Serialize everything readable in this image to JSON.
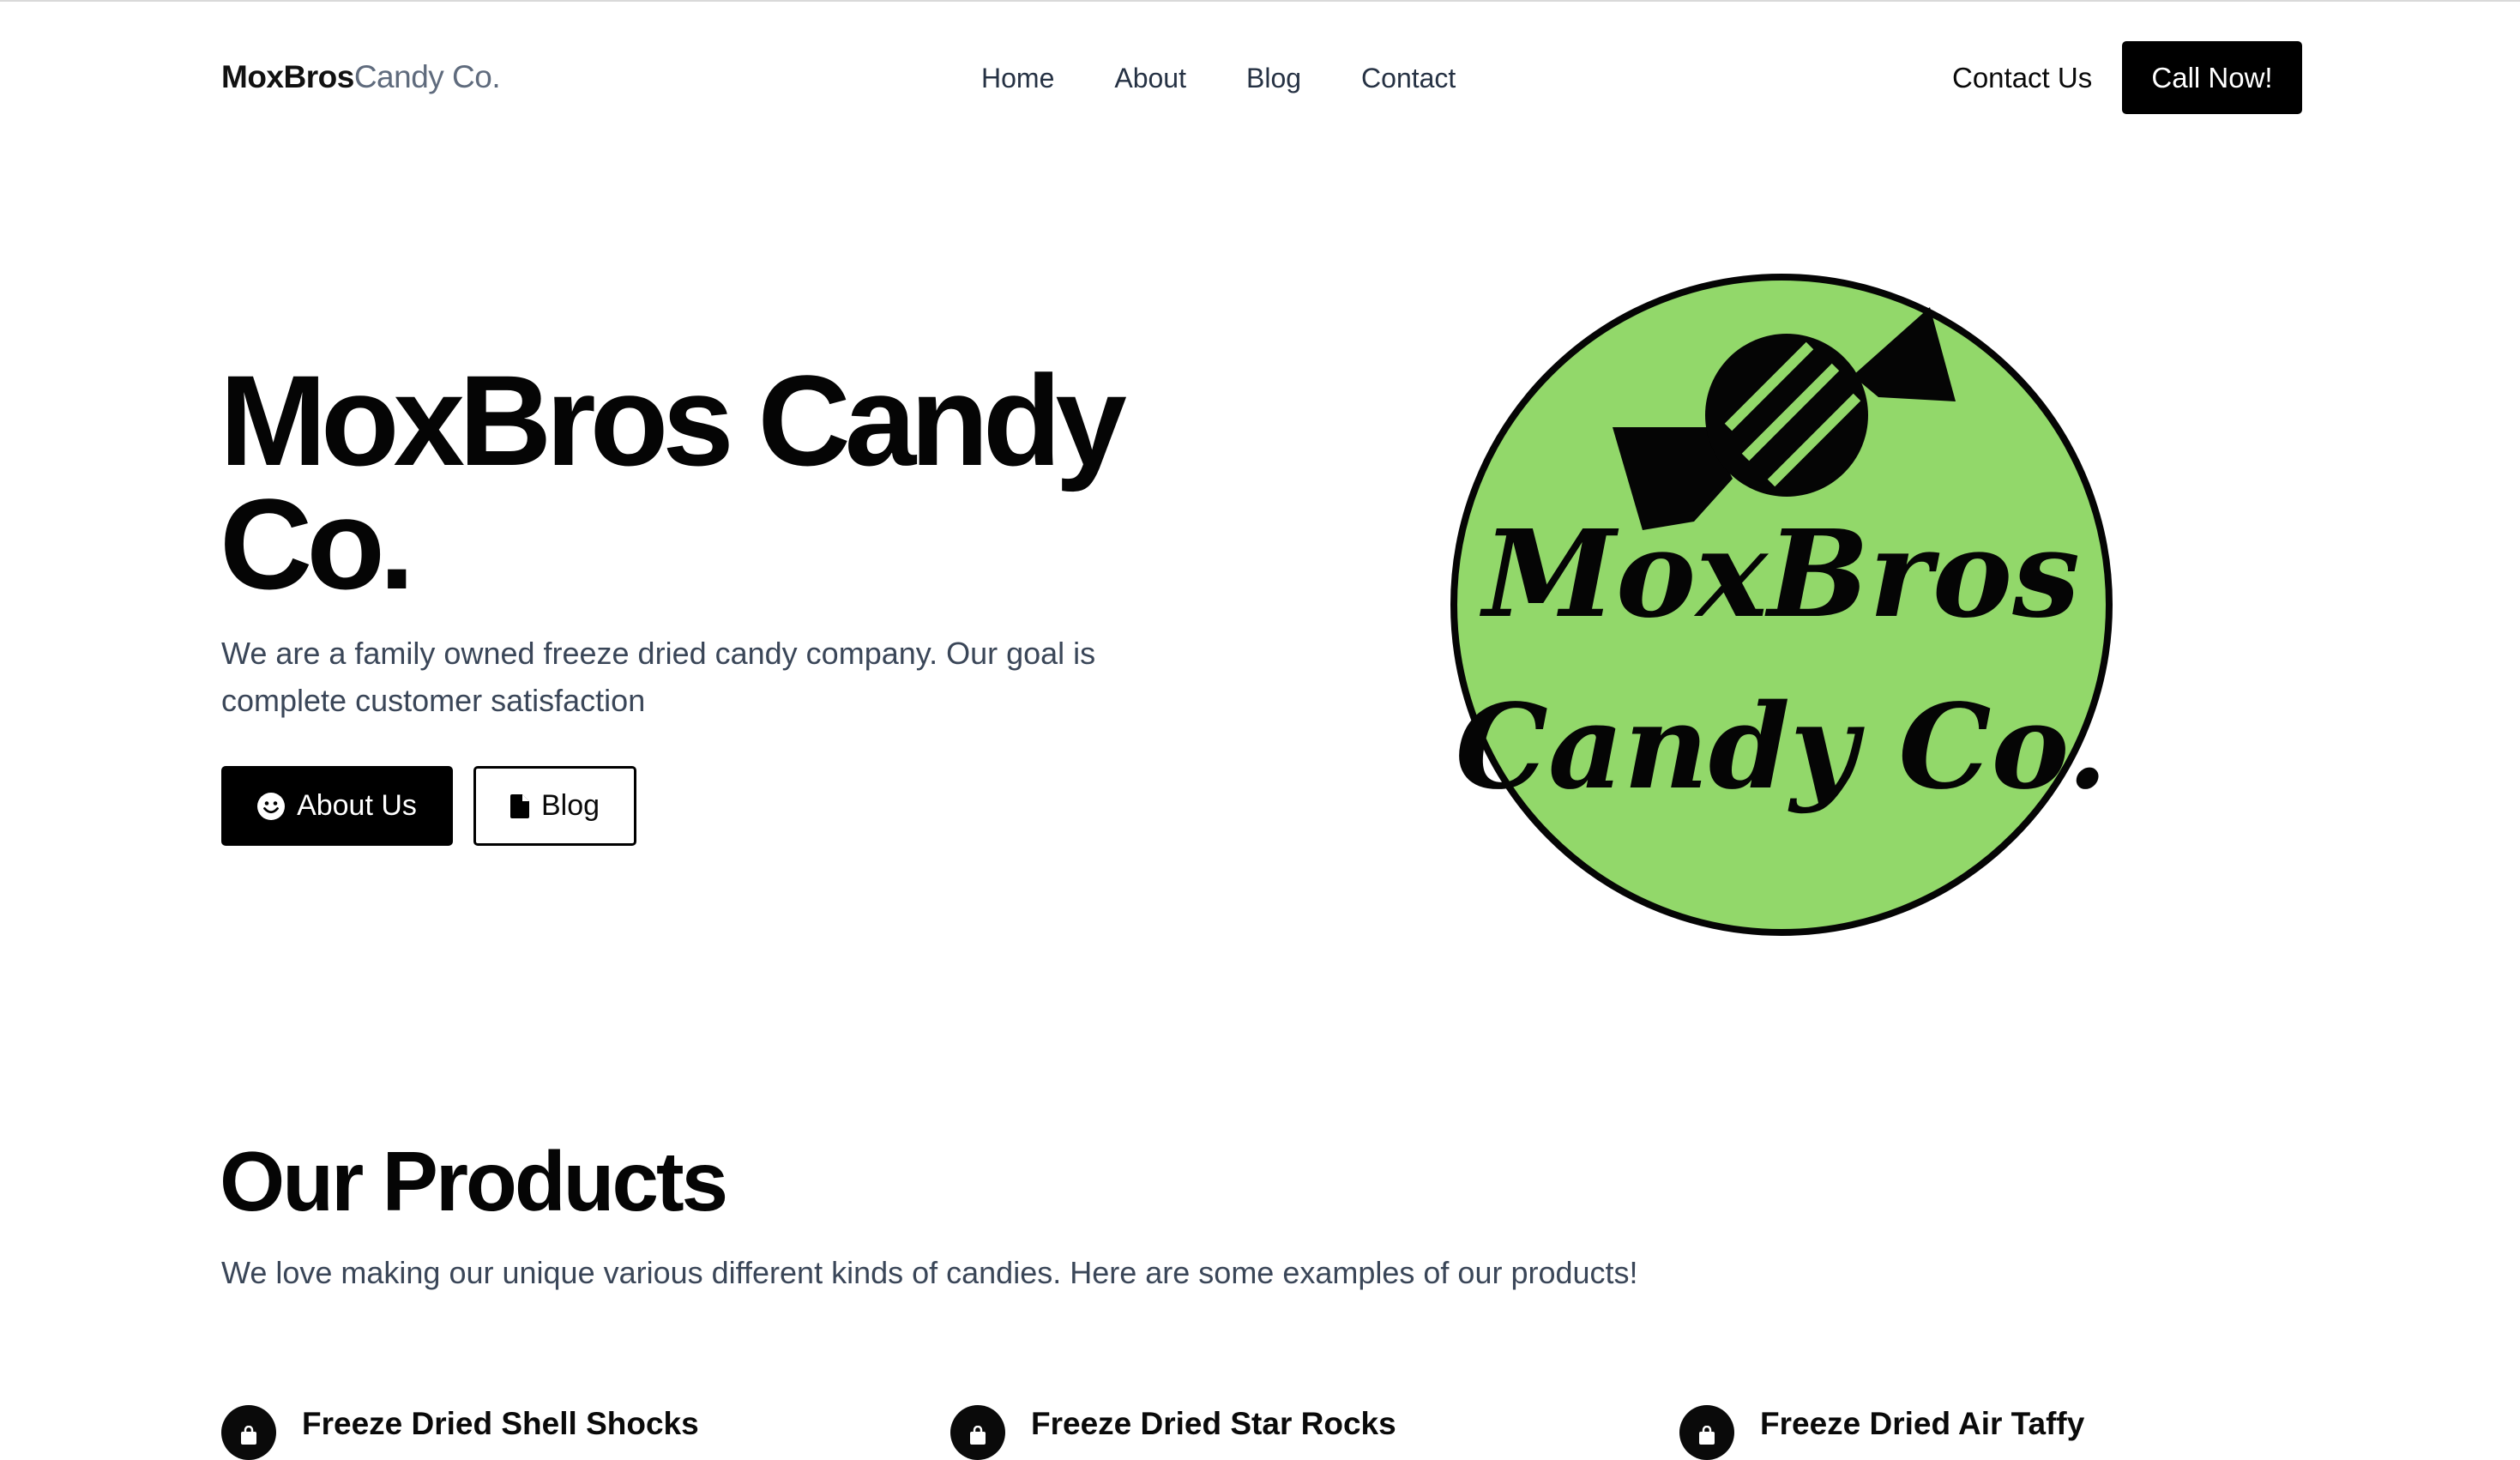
{
  "nav": {
    "brand_bold": "MoxBros",
    "brand_light": "Candy Co.",
    "links": [
      "Home",
      "About",
      "Blog",
      "Contact"
    ],
    "contact_label": "Contact Us",
    "call_label": "Call Now!"
  },
  "hero": {
    "title": "MoxBros Candy Co.",
    "subtitle": "We are a family owned freeze dried candy company. Our goal is complete customer satisfaction",
    "about_button": "About Us",
    "blog_button": "Blog",
    "logo_line1": "MoxBros",
    "logo_line2": "Candy Co.",
    "logo_color": "#92d86a"
  },
  "products": {
    "title": "Our Products",
    "subtitle": "We love making our unique various different kinds of candies. Here are some examples of our products!",
    "items": [
      {
        "name": "Freeze Dried Shell Shocks",
        "icon": "shopping-bag-icon"
      },
      {
        "name": "Freeze Dried Star Rocks",
        "icon": "shopping-bag-icon"
      },
      {
        "name": "Freeze Dried Air Taffy",
        "icon": "shopping-bag-icon"
      }
    ]
  },
  "colors": {
    "primary": "#000000",
    "text_muted": "#3a4658",
    "brand_muted": "#5f6b7d",
    "logo_green": "#92d86a"
  }
}
